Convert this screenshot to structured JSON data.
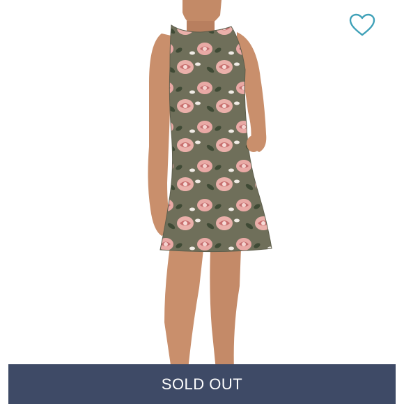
{
  "listing": {
    "favorite_icon": "heart-outline-icon",
    "sold_out_label": "SOLD OUT"
  },
  "colors": {
    "background": "#ffffff",
    "favorite_icon": "#3fa1b8",
    "banner": "#3e4a66",
    "banner_text": "#ffffff",
    "dress_base": "#6f6f5a",
    "rose_pink": "#e9a9a5",
    "leaf_green": "#3f4a35",
    "skin": "#c98f6c"
  }
}
